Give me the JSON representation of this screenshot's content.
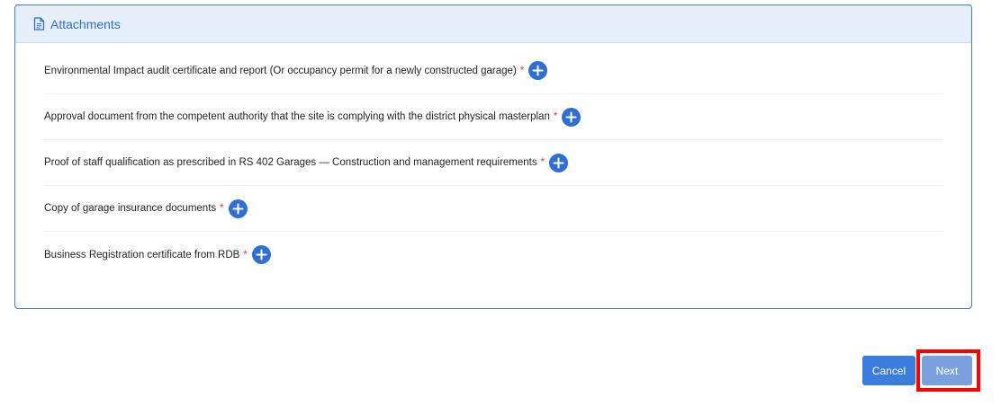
{
  "card": {
    "header_icon": "document-icon",
    "title": "Attachments"
  },
  "attachments": [
    {
      "label": "Environmental Impact audit certificate and report (Or occupancy permit for a newly constructed garage)",
      "required_mark": "*"
    },
    {
      "label": "Approval document from the competent authority that the site is complying with the district physical masterplan",
      "required_mark": "*"
    },
    {
      "label": "Proof of staff qualification as prescribed in RS 402 Garages — Construction and management requirements",
      "required_mark": "*"
    },
    {
      "label": "Copy of garage insurance documents",
      "required_mark": "*"
    },
    {
      "label": "Business Registration certificate from RDB",
      "required_mark": "*"
    }
  ],
  "actions": {
    "cancel_label": "Cancel",
    "next_label": "Next"
  },
  "colors": {
    "accent": "#3b7ddd",
    "required": "#dc3545",
    "highlight": "#ff0000"
  }
}
